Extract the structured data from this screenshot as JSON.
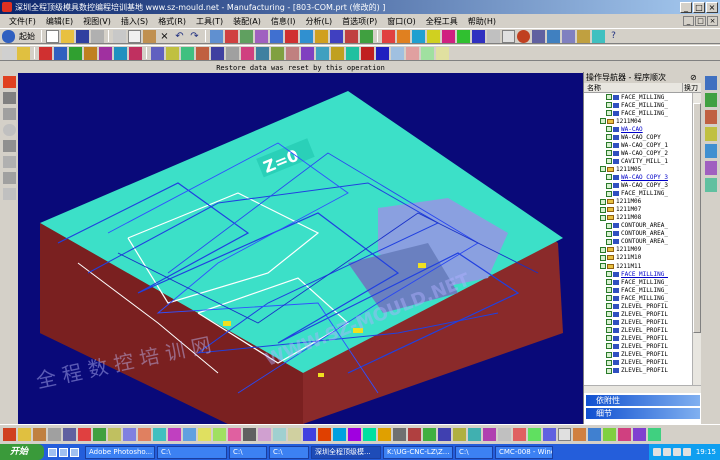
{
  "window": {
    "title": "深圳全程顶级模具数控编程培训基地 www.sz-mould.net - Manufacturing - [803-COM.prt (修改的) ]"
  },
  "menu": [
    "文件(F)",
    "编辑(E)",
    "视图(V)",
    "插入(S)",
    "格式(R)",
    "工具(T)",
    "装配(A)",
    "信息(I)",
    "分析(L)",
    "首选项(P)",
    "窗口(O)",
    "全程工具",
    "帮助(H)"
  ],
  "toolbar": {
    "start_label": "起始"
  },
  "viewport": {
    "status_message": "Restore data was reset by this operation",
    "part_label": "Z=0",
    "watermark_url": "WWW.SZ-MOULD.NET",
    "watermark_text": "全 程 数 控 培 训 网"
  },
  "navigator": {
    "title": "操作导航器 - 程序顺次",
    "col_name": "名称",
    "col_tool": "换刀",
    "rows": [
      {
        "label": "FACE_MILLING_",
        "kind": "op",
        "hl": false
      },
      {
        "label": "FACE_MILLING_",
        "kind": "op",
        "hl": false
      },
      {
        "label": "FACE_MILLING_",
        "kind": "op",
        "hl": false
      },
      {
        "label": "1211M04",
        "kind": "group",
        "hl": false
      },
      {
        "label": "WA-CAO",
        "kind": "op",
        "hl": true
      },
      {
        "label": "WA-CAO_COPY",
        "kind": "op",
        "hl": false
      },
      {
        "label": "WA-CAO_COPY_1",
        "kind": "op",
        "hl": false
      },
      {
        "label": "WA-CAO_COPY_2",
        "kind": "op",
        "hl": false
      },
      {
        "label": "CAVITY_MILL_1",
        "kind": "op",
        "hl": false
      },
      {
        "label": "1211M05",
        "kind": "group",
        "hl": false
      },
      {
        "label": "WA-CAO_COPY_3",
        "kind": "op",
        "hl": true
      },
      {
        "label": "WA-CAO_COPY_3",
        "kind": "op",
        "hl": false
      },
      {
        "label": "FACE_MILLING_",
        "kind": "op",
        "hl": false
      },
      {
        "label": "1211M06",
        "kind": "group",
        "hl": false
      },
      {
        "label": "1211M07",
        "kind": "group",
        "hl": false
      },
      {
        "label": "1211M08",
        "kind": "group",
        "hl": false
      },
      {
        "label": "CONTOUR_AREA_",
        "kind": "op",
        "hl": false
      },
      {
        "label": "CONTOUR_AREA_",
        "kind": "op",
        "hl": false
      },
      {
        "label": "CONTOUR_AREA_",
        "kind": "op",
        "hl": false
      },
      {
        "label": "1211M09",
        "kind": "group",
        "hl": false
      },
      {
        "label": "1211M10",
        "kind": "group",
        "hl": false
      },
      {
        "label": "1211M11",
        "kind": "group",
        "hl": false
      },
      {
        "label": "FACE_MILLING_",
        "kind": "op",
        "hl": true
      },
      {
        "label": "FACE_MILLING_",
        "kind": "op",
        "hl": false
      },
      {
        "label": "FACE_MILLING_",
        "kind": "op",
        "hl": false
      },
      {
        "label": "FACE_MILLING_",
        "kind": "op",
        "hl": false
      },
      {
        "label": "ZLEVEL_PROFIL",
        "kind": "op",
        "hl": false
      },
      {
        "label": "ZLEVEL_PROFIL",
        "kind": "op",
        "hl": false
      },
      {
        "label": "ZLEVEL_PROFIL",
        "kind": "op",
        "hl": false
      },
      {
        "label": "ZLEVEL_PROFIL",
        "kind": "op",
        "hl": false
      },
      {
        "label": "ZLEVEL_PROFIL",
        "kind": "op",
        "hl": false
      },
      {
        "label": "ZLEVEL_PROFIL",
        "kind": "op",
        "hl": false
      },
      {
        "label": "ZLEVEL_PROFIL",
        "kind": "op",
        "hl": false
      },
      {
        "label": "ZLEVEL_PROFIL",
        "kind": "op",
        "hl": false
      },
      {
        "label": "ZLEVEL_PROFIL",
        "kind": "op",
        "hl": false
      }
    ],
    "panel_attached": "依附性",
    "panel_details": "细节"
  },
  "taskbar": {
    "start": "开始",
    "tasks": [
      {
        "label": "Adobe Photosho...",
        "active": false
      },
      {
        "label": "C:\\",
        "active": false
      },
      {
        "label": "C:\\",
        "active": false
      },
      {
        "label": "C:\\",
        "active": false
      },
      {
        "label": "深圳全程顶级模...",
        "active": true
      },
      {
        "label": "K:\\UG-CNC-LZ\\Z...",
        "active": false
      },
      {
        "label": "C:\\",
        "active": false
      },
      {
        "label": "CMC-008 - Wind...",
        "active": false
      }
    ],
    "clock": "19:15"
  },
  "colors": {
    "viewport_bg": "#090979",
    "part_face": "#3ce0c8",
    "part_side": "#8a2a2a",
    "toolpath": "#2040e0",
    "title_bar": "#0a246a"
  }
}
